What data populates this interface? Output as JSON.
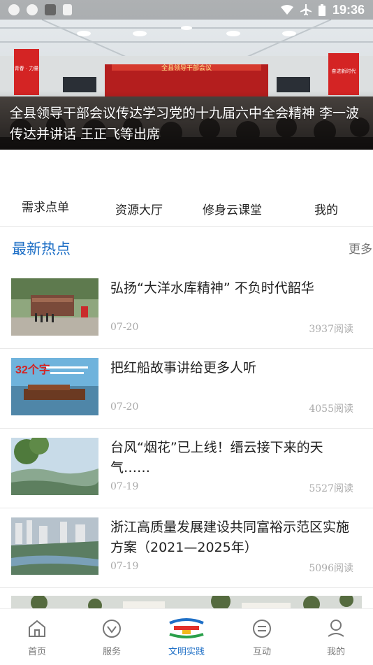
{
  "status_bar": {
    "time": "19:36"
  },
  "hero": {
    "banner_text": "全县领导干部会议",
    "left_banner_text": "青春 · 力量",
    "right_banner_text": "奋进新时代",
    "caption": "全县领导干部会议传达学习党的十九届六中全会精神 李一波传达并讲话 王正飞等出席"
  },
  "tabs": [
    {
      "label": "需求点单"
    },
    {
      "label": "资源大厅"
    },
    {
      "label": "修身云课堂"
    },
    {
      "label": "我的"
    }
  ],
  "section": {
    "title": "最新热点",
    "more": "更多"
  },
  "news": [
    {
      "title": "弘扬“大洋水库精神” 不负时代韶华",
      "date": "07-20",
      "reads": "3937阅读"
    },
    {
      "title": "把红船故事讲给更多人听",
      "date": "07-20",
      "reads": "4055阅读",
      "thumb_text": "32个字"
    },
    {
      "title": "台风“烟花”已上线！缙云接下来的天气……",
      "date": "07-19",
      "reads": "5527阅读"
    },
    {
      "title": "浙江高质量发展建设共同富裕示范区实施方案（2021—2025年）",
      "date": "07-19",
      "reads": "5096阅读"
    }
  ],
  "bottom_nav": [
    {
      "label": "首页",
      "icon": "home-icon"
    },
    {
      "label": "服务",
      "icon": "diamond-icon"
    },
    {
      "label": "文明实践",
      "icon": "civilization-logo-icon",
      "active": true
    },
    {
      "label": "互动",
      "icon": "chat-icon"
    },
    {
      "label": "我的",
      "icon": "user-icon"
    }
  ],
  "colors": {
    "accent": "#1e6fc6",
    "text": "#222222",
    "muted": "#aaaaaa"
  }
}
